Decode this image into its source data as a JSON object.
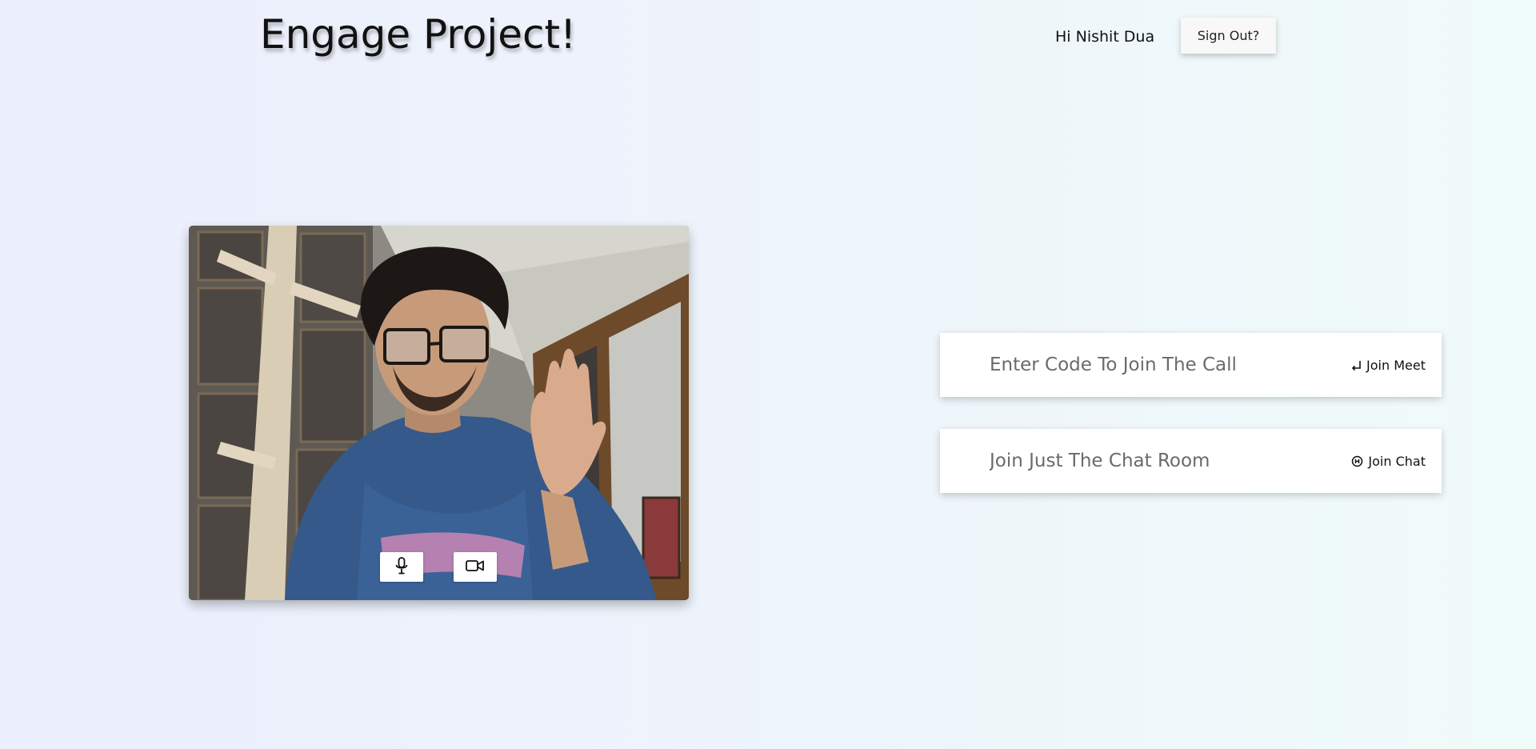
{
  "header": {
    "title": "Engage Project!",
    "greeting": "Hi Nishit Dua",
    "signout_label": "Sign Out?"
  },
  "video": {
    "mic_icon": "microphone-icon",
    "camera_icon": "video-camera-icon"
  },
  "meet": {
    "placeholder": "Enter Code To Join The Call",
    "button_label": "Join Meet",
    "button_icon": "enter-icon"
  },
  "chat": {
    "placeholder": "Join Just The Chat Room",
    "button_label": "Join Chat",
    "button_icon": "chat-icon"
  },
  "colors": {
    "background_left": "#eceffd",
    "background_right": "#f0fcf9",
    "card": "#ffffff"
  }
}
